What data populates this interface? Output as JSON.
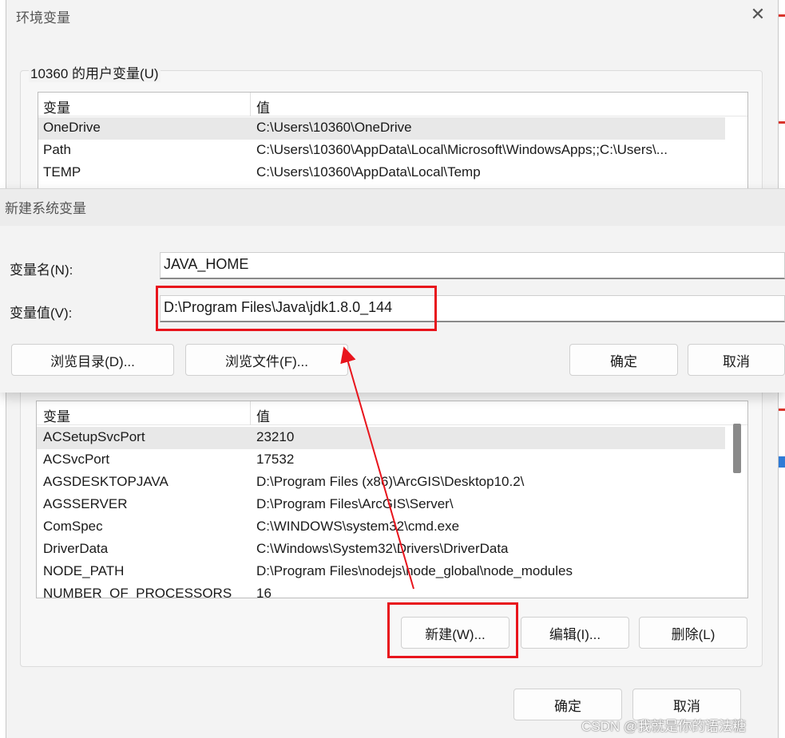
{
  "env_window": {
    "title": "环境变量",
    "close_glyph": "✕",
    "user_group_label": "10360 的用户变量(U)",
    "user_vars": {
      "headers": [
        "变量",
        "值"
      ],
      "rows": [
        {
          "name": "OneDrive",
          "value": "C:\\Users\\10360\\OneDrive"
        },
        {
          "name": "Path",
          "value": "C:\\Users\\10360\\AppData\\Local\\Microsoft\\WindowsApps;;C:\\Users\\..."
        },
        {
          "name": "TEMP",
          "value": "C:\\Users\\10360\\AppData\\Local\\Temp"
        }
      ]
    },
    "system_vars": {
      "headers": [
        "变量",
        "值"
      ],
      "rows": [
        {
          "name": "ACSetupSvcPort",
          "value": "23210"
        },
        {
          "name": "ACSvcPort",
          "value": "17532"
        },
        {
          "name": "AGSDESKTOPJAVA",
          "value": "D:\\Program Files (x86)\\ArcGIS\\Desktop10.2\\"
        },
        {
          "name": "AGSSERVER",
          "value": "D:\\Program Files\\ArcGIS\\Server\\"
        },
        {
          "name": "ComSpec",
          "value": "C:\\WINDOWS\\system32\\cmd.exe"
        },
        {
          "name": "DriverData",
          "value": "C:\\Windows\\System32\\Drivers\\DriverData"
        },
        {
          "name": "NODE_PATH",
          "value": "D:\\Program Files\\nodejs\\node_global\\node_modules"
        },
        {
          "name": "NUMBER_OF_PROCESSORS",
          "value": "16"
        }
      ]
    },
    "system_buttons": {
      "new": "新建(W)...",
      "edit": "编辑(I)...",
      "delete": "删除(L)"
    },
    "footer_buttons": {
      "ok": "确定",
      "cancel": "取消"
    }
  },
  "new_var_dialog": {
    "title": "新建系统变量",
    "name_label": "变量名(N):",
    "name_value": "JAVA_HOME",
    "value_label": "变量值(V):",
    "value_value": "D:\\Program Files\\Java\\jdk1.8.0_144",
    "buttons": {
      "browse_dir": "浏览目录(D)...",
      "browse_file": "浏览文件(F)...",
      "ok": "确定",
      "cancel": "取消"
    }
  },
  "watermark": "CSDN @我就是你的语法糖",
  "colors": {
    "highlight": "#e8141c",
    "arrow": "#e8141c"
  }
}
